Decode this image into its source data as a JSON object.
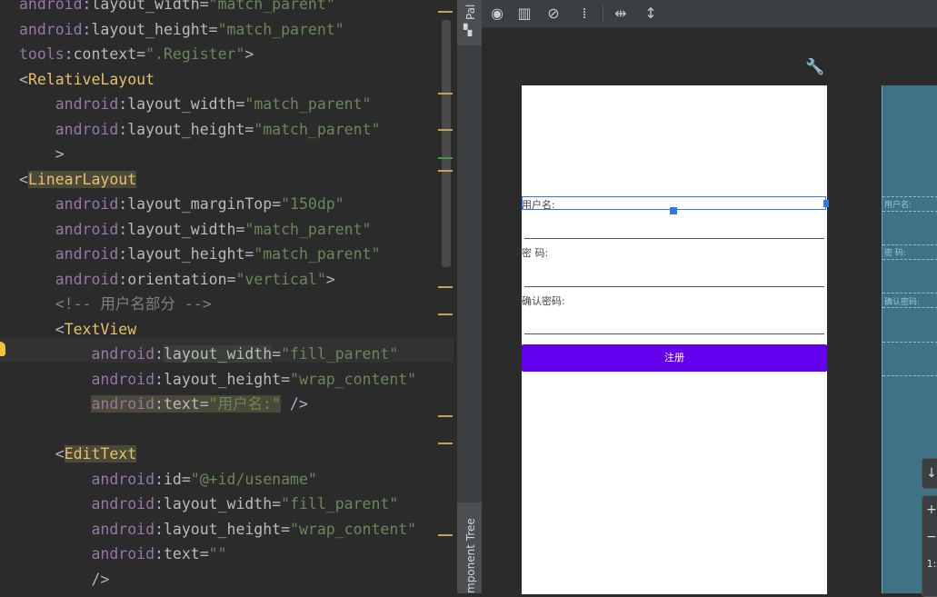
{
  "editor": {
    "lines": [
      {
        "indent": "",
        "parts": [
          {
            "t": "android",
            "c": "ns"
          },
          {
            "t": ":",
            "c": ""
          },
          {
            "t": "layout_width",
            "c": "attr"
          },
          {
            "t": "=",
            "c": ""
          },
          {
            "t": "\"match_parent\"",
            "c": "str"
          }
        ]
      },
      {
        "indent": "",
        "parts": [
          {
            "t": "android",
            "c": "ns"
          },
          {
            "t": ":",
            "c": ""
          },
          {
            "t": "layout_height",
            "c": "attr"
          },
          {
            "t": "=",
            "c": ""
          },
          {
            "t": "\"match_parent\"",
            "c": "str"
          }
        ]
      },
      {
        "indent": "",
        "parts": [
          {
            "t": "tools",
            "c": "ns"
          },
          {
            "t": ":",
            "c": ""
          },
          {
            "t": "context",
            "c": "attr"
          },
          {
            "t": "=",
            "c": ""
          },
          {
            "t": "\".Register\"",
            "c": "str"
          },
          {
            "t": ">",
            "c": ""
          }
        ]
      },
      {
        "indent": "",
        "parts": [
          {
            "t": "<",
            "c": ""
          },
          {
            "t": "RelativeLayout",
            "c": "tag"
          }
        ]
      },
      {
        "indent": "    ",
        "parts": [
          {
            "t": "android",
            "c": "ns"
          },
          {
            "t": ":",
            "c": ""
          },
          {
            "t": "layout_width",
            "c": "attr"
          },
          {
            "t": "=",
            "c": ""
          },
          {
            "t": "\"match_parent\"",
            "c": "str"
          }
        ]
      },
      {
        "indent": "    ",
        "parts": [
          {
            "t": "android",
            "c": "ns"
          },
          {
            "t": ":",
            "c": ""
          },
          {
            "t": "layout_height",
            "c": "attr"
          },
          {
            "t": "=",
            "c": ""
          },
          {
            "t": "\"match_parent\"",
            "c": "str"
          }
        ]
      },
      {
        "indent": "    ",
        "parts": [
          {
            "t": ">",
            "c": ""
          }
        ]
      },
      {
        "indent": "",
        "parts": [
          {
            "t": "<",
            "c": ""
          },
          {
            "t": "LinearLayout",
            "c": "tag tagbg"
          }
        ]
      },
      {
        "indent": "    ",
        "parts": [
          {
            "t": "android",
            "c": "ns"
          },
          {
            "t": ":",
            "c": ""
          },
          {
            "t": "layout_marginTop",
            "c": "attr"
          },
          {
            "t": "=",
            "c": ""
          },
          {
            "t": "\"150dp\"",
            "c": "str"
          }
        ]
      },
      {
        "indent": "    ",
        "parts": [
          {
            "t": "android",
            "c": "ns"
          },
          {
            "t": ":",
            "c": ""
          },
          {
            "t": "layout_width",
            "c": "attr"
          },
          {
            "t": "=",
            "c": ""
          },
          {
            "t": "\"match_parent\"",
            "c": "str"
          }
        ]
      },
      {
        "indent": "    ",
        "parts": [
          {
            "t": "android",
            "c": "ns"
          },
          {
            "t": ":",
            "c": ""
          },
          {
            "t": "layout_height",
            "c": "attr"
          },
          {
            "t": "=",
            "c": ""
          },
          {
            "t": "\"match_parent\"",
            "c": "str"
          }
        ]
      },
      {
        "indent": "    ",
        "parts": [
          {
            "t": "android",
            "c": "ns"
          },
          {
            "t": ":",
            "c": ""
          },
          {
            "t": "orientation",
            "c": "attr"
          },
          {
            "t": "=",
            "c": ""
          },
          {
            "t": "\"vertical\"",
            "c": "str"
          },
          {
            "t": ">",
            "c": ""
          }
        ]
      },
      {
        "indent": "    ",
        "parts": [
          {
            "t": "<!-- 用户名部分 -->",
            "c": "cmt"
          }
        ]
      },
      {
        "indent": "    ",
        "parts": [
          {
            "t": "<",
            "c": ""
          },
          {
            "t": "TextView",
            "c": "tag"
          }
        ]
      },
      {
        "indent": "        ",
        "parts": [
          {
            "t": "android",
            "c": "ns"
          },
          {
            "t": ":",
            "c": ""
          },
          {
            "t": "layout_width",
            "c": "attr hlbg"
          },
          {
            "t": "=",
            "c": ""
          },
          {
            "t": "\"fill_parent\"",
            "c": "str"
          }
        ]
      },
      {
        "indent": "        ",
        "parts": [
          {
            "t": "android",
            "c": "ns"
          },
          {
            "t": ":",
            "c": ""
          },
          {
            "t": "layout_height",
            "c": "attr"
          },
          {
            "t": "=",
            "c": ""
          },
          {
            "t": "\"wrap_content\"",
            "c": "str"
          }
        ]
      },
      {
        "indent": "        ",
        "parts": [
          {
            "t": "android",
            "c": "ns tagbg"
          },
          {
            "t": ":",
            "c": "tagbg"
          },
          {
            "t": "text",
            "c": "attr tagbg"
          },
          {
            "t": "=",
            "c": "tagbg"
          },
          {
            "t": "\"用户名:\"",
            "c": "str tagbg"
          },
          {
            "t": " />",
            "c": ""
          }
        ]
      },
      {
        "indent": "",
        "parts": [
          {
            "t": "",
            "c": ""
          }
        ]
      },
      {
        "indent": "    ",
        "parts": [
          {
            "t": "<",
            "c": ""
          },
          {
            "t": "EditText",
            "c": "tag tagbg"
          }
        ]
      },
      {
        "indent": "        ",
        "parts": [
          {
            "t": "android",
            "c": "ns"
          },
          {
            "t": ":",
            "c": ""
          },
          {
            "t": "id",
            "c": "attr"
          },
          {
            "t": "=",
            "c": ""
          },
          {
            "t": "\"@+id/usename\"",
            "c": "str"
          }
        ]
      },
      {
        "indent": "        ",
        "parts": [
          {
            "t": "android",
            "c": "ns"
          },
          {
            "t": ":",
            "c": ""
          },
          {
            "t": "layout_width",
            "c": "attr"
          },
          {
            "t": "=",
            "c": ""
          },
          {
            "t": "\"fill_parent\"",
            "c": "str"
          }
        ]
      },
      {
        "indent": "        ",
        "parts": [
          {
            "t": "android",
            "c": "ns"
          },
          {
            "t": ":",
            "c": ""
          },
          {
            "t": "layout_height",
            "c": "attr"
          },
          {
            "t": "=",
            "c": ""
          },
          {
            "t": "\"wrap_content\"",
            "c": "str"
          }
        ]
      },
      {
        "indent": "        ",
        "parts": [
          {
            "t": "android",
            "c": "ns"
          },
          {
            "t": ":",
            "c": ""
          },
          {
            "t": "text",
            "c": "attr"
          },
          {
            "t": "=",
            "c": ""
          },
          {
            "t": "\"\"",
            "c": "str"
          }
        ]
      },
      {
        "indent": "        ",
        "parts": [
          {
            "t": "/>",
            "c": ""
          }
        ]
      }
    ]
  },
  "side_tabs": {
    "palette": "Pal",
    "component_tree": "mponent Tree"
  },
  "toolbar": {
    "icons": [
      "eye-icon",
      "blueprint-icon",
      "magnet-off-icon",
      "constraint-errors-icon",
      "pack-horizontal-icon",
      "pack-vertical-icon"
    ]
  },
  "design": {
    "username_label": "用户名:",
    "password_label": "密 码:",
    "confirm_label": "确认密码:",
    "register_button": "注册",
    "button_color": "#6200ee",
    "selection_color": "#2d7be0"
  },
  "blueprint": {
    "username_label": "用户名:",
    "password_label": "密 码:",
    "confirm_label": "确认密码:"
  },
  "zoom_controls": {
    "zoom_in": "+",
    "zoom_out": "−",
    "ratio": "1:",
    "pan": "↓"
  }
}
